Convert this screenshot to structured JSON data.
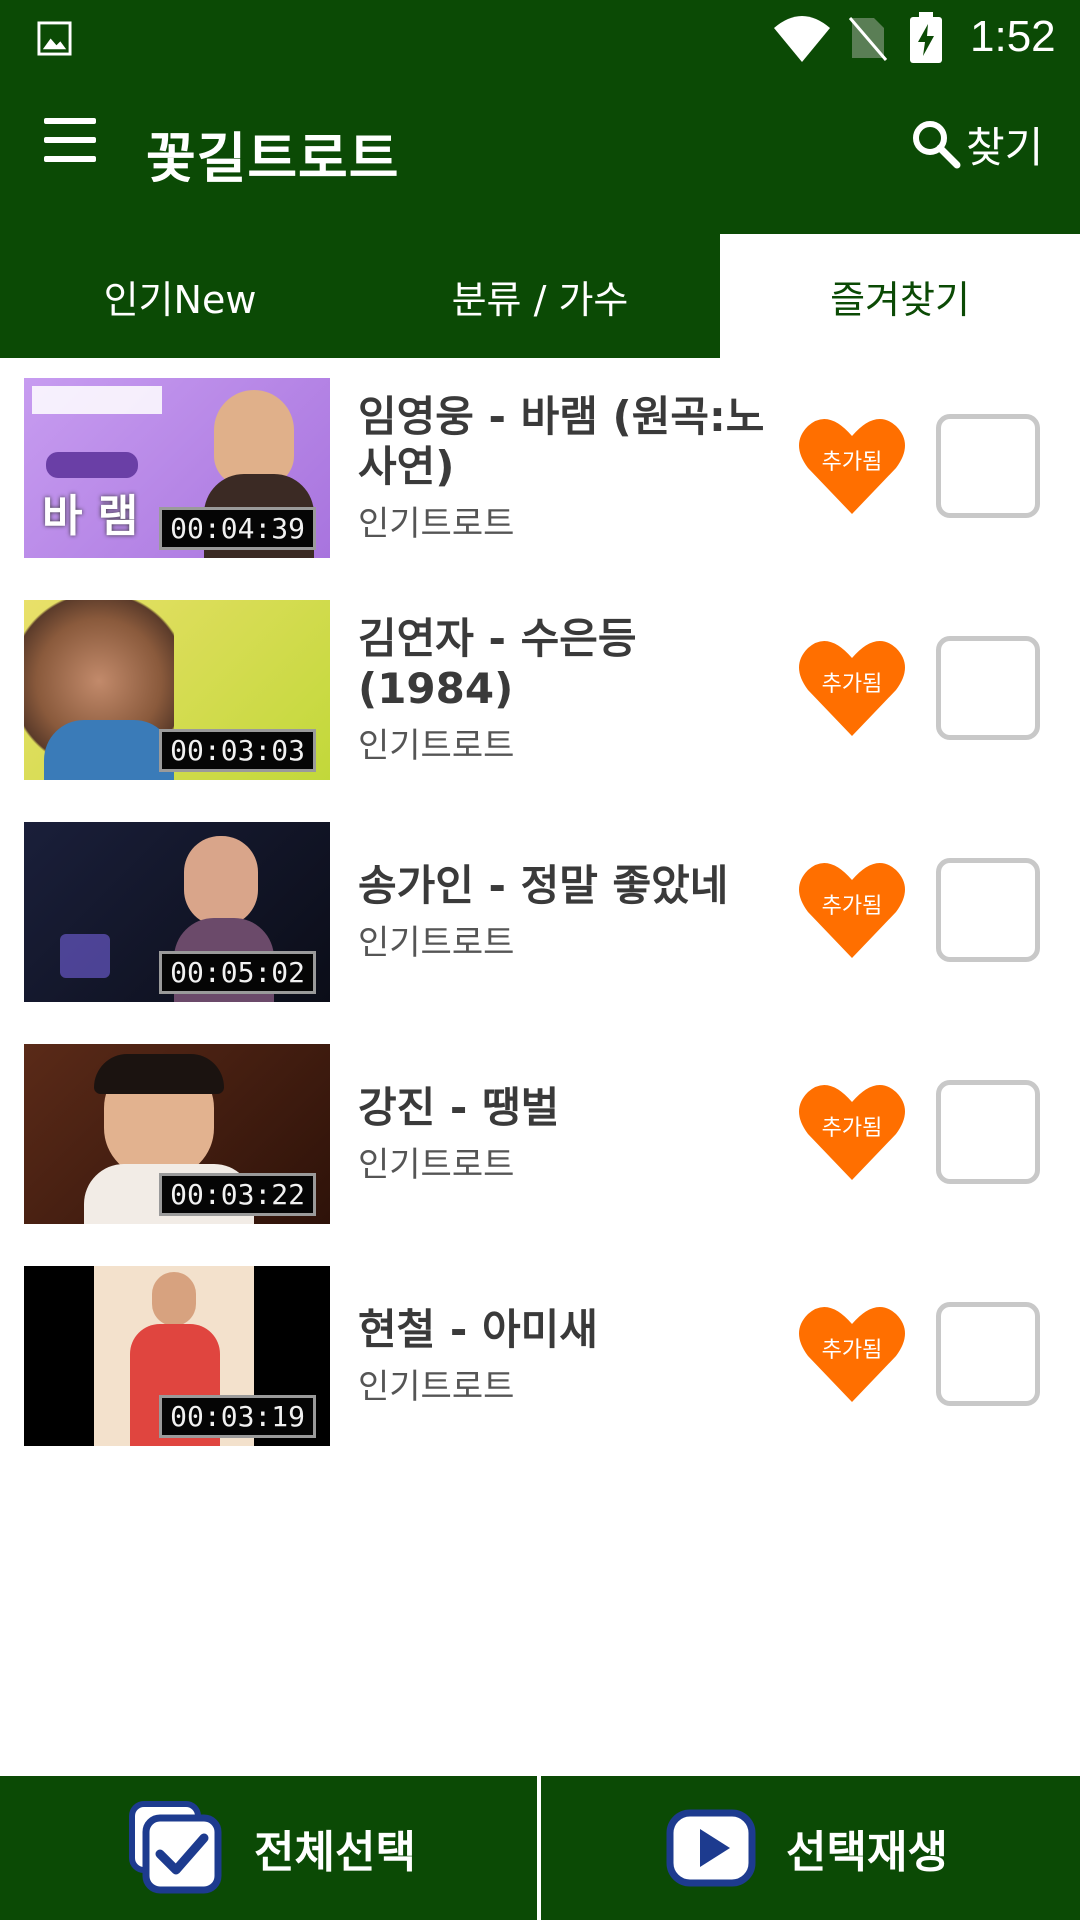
{
  "status_bar": {
    "time": "1:52"
  },
  "app_bar": {
    "title": "꽃길트로트",
    "search_label": "찾기"
  },
  "tabs": [
    {
      "label": "인기New",
      "active": false
    },
    {
      "label": "분류 / 가수",
      "active": false
    },
    {
      "label": "즐겨찾기",
      "active": true
    }
  ],
  "items": [
    {
      "title": "임영웅 - 바램 (원곡:노사연)",
      "source": "인기트로트",
      "duration": "00:04:39",
      "thumb_caption": "바 램",
      "favorite_label": "추가됨"
    },
    {
      "title": "김연자 - 수은등 (1984)",
      "source": "인기트로트",
      "duration": "00:03:03",
      "thumb_caption": "",
      "favorite_label": "추가됨"
    },
    {
      "title": "송가인 - 정말 좋았네",
      "source": "인기트로트",
      "duration": "00:05:02",
      "thumb_caption": "",
      "favorite_label": "추가됨"
    },
    {
      "title": "강진 - 땡벌",
      "source": "인기트로트",
      "duration": "00:03:22",
      "thumb_caption": "",
      "favorite_label": "추가됨"
    },
    {
      "title": "현철 - 아미새",
      "source": "인기트로트",
      "duration": "00:03:19",
      "thumb_caption": "",
      "favorite_label": "추가됨"
    }
  ],
  "bottom_bar": {
    "select_all_label": "전체선택",
    "play_selected_label": "선택재생"
  },
  "colors": {
    "primary": "#0b4a05",
    "heart": "#ff6f00",
    "checkbox_border": "#c8c8c8"
  }
}
